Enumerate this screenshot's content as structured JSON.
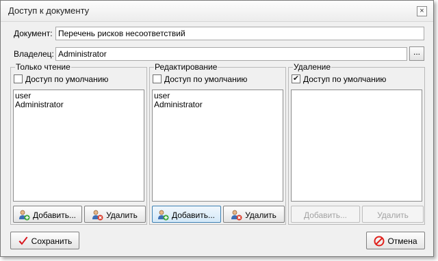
{
  "window": {
    "title": "Доступ к документу",
    "close_glyph": "×"
  },
  "document": {
    "label": "Документ:",
    "value": "Перечень рисков несоответствий"
  },
  "owner": {
    "label": "Владелец:",
    "value": "Administrator",
    "browse_label": "..."
  },
  "groups": [
    {
      "title": "Только чтение",
      "default_access_label": "Доступ по умолчанию",
      "default_access_checked": false,
      "users": [
        "user",
        "Administrator"
      ],
      "add_label": "Добавить...",
      "remove_label": "Удалить",
      "buttons_enabled": true
    },
    {
      "title": "Редактирование",
      "default_access_label": "Доступ по умолчанию",
      "default_access_checked": false,
      "users": [
        "user",
        "Administrator"
      ],
      "add_label": "Добавить...",
      "remove_label": "Удалить",
      "buttons_enabled": true
    },
    {
      "title": "Удаление",
      "default_access_label": "Доступ по умолчанию",
      "default_access_checked": true,
      "check_glyph": "✔",
      "users": [],
      "add_label": "Добавить...",
      "remove_label": "Удалить",
      "buttons_enabled": false
    }
  ],
  "footer": {
    "save_label": "Сохранить",
    "cancel_label": "Отмена"
  },
  "colors": {
    "check_red": "#d8121b",
    "cancel_red": "#e0201b",
    "user_green": "#3aa63a",
    "user_red": "#d93b2b"
  },
  "icons": {
    "add_user": "add-user-icon",
    "remove_user": "remove-user-icon",
    "save": "checkmark-icon",
    "cancel": "no-entry-icon"
  }
}
